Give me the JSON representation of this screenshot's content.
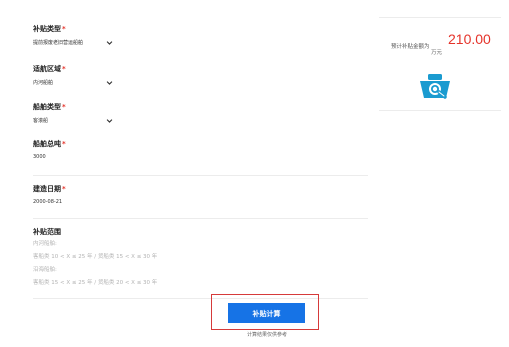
{
  "form": {
    "subsidy_type": {
      "label": "补贴类型",
      "required_mark": "*",
      "value": "提前报废老旧营运船舶"
    },
    "navigation_area": {
      "label": "适航区域",
      "required_mark": "*",
      "value": "内河船舶"
    },
    "ship_type": {
      "label": "船舶类型",
      "required_mark": "*",
      "value": "客滚船"
    },
    "gross_tonnage": {
      "label": "船舶总吨",
      "required_mark": "*",
      "value": "3000"
    },
    "build_date": {
      "label": "建造日期",
      "required_mark": "*",
      "value": "2000-08-21"
    },
    "subsidy_range": {
      "title": "补贴范围",
      "lines": [
        "内河船舶:",
        "客船类 10 < X ≤ 25 年 / 货船类 15 < X ≤ 30 年",
        "沿海船舶:",
        "客船类 15 < X ≤ 25 年 / 货船类 20 < X ≤ 30 年"
      ]
    }
  },
  "action": {
    "calc_label": "补贴计算",
    "note": "计算结果仅供参考"
  },
  "result": {
    "label": "预计补贴金额为",
    "amount": "210.00",
    "unit": "万元"
  },
  "icons": {
    "dropdown": "chevron-down-icon",
    "logo": "ship-search-icon"
  },
  "colors": {
    "accent": "#1673e6",
    "required": "#e5332a",
    "amount": "#e5332a",
    "highlight_border": "#d63a3a",
    "logo": "#1a9bd0"
  }
}
